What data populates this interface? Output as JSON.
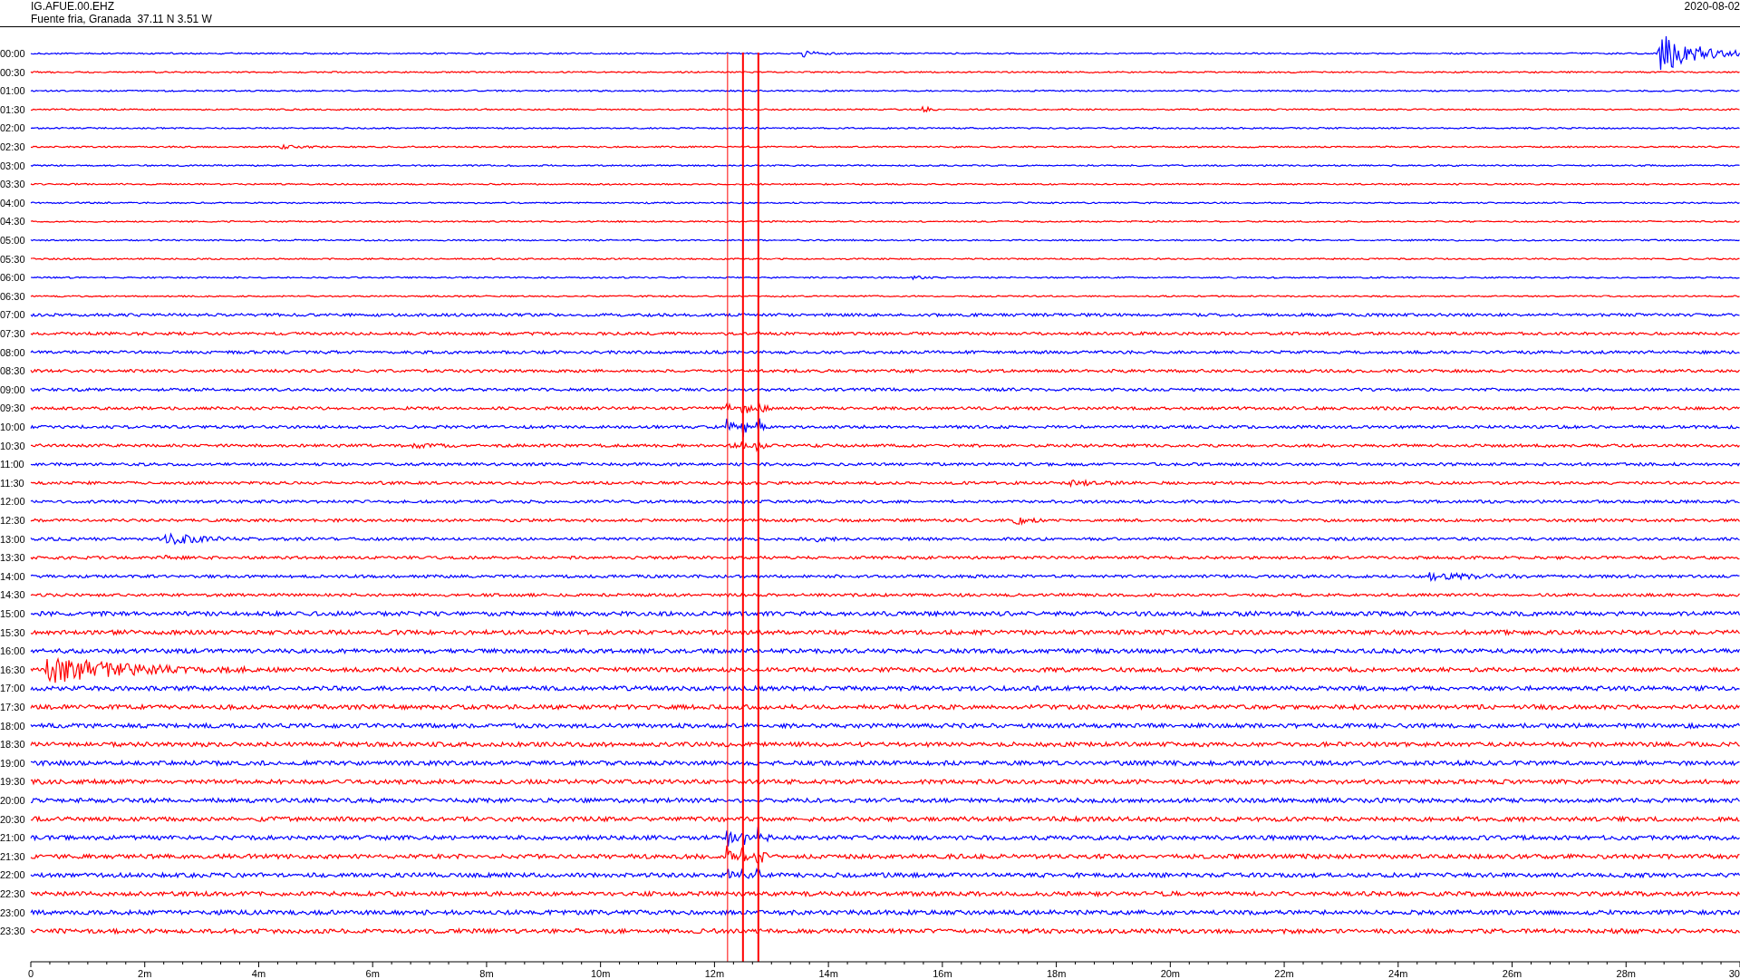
{
  "header": {
    "station": "IG.AFUE.00.EHZ",
    "location": "Fuente fria, Granada  37.11 N 3.51 W",
    "date": "2020-08-02"
  },
  "rows": [
    {
      "time": "00:00",
      "color": "#0000ff"
    },
    {
      "time": "00:30",
      "color": "#ff0000"
    },
    {
      "time": "01:00",
      "color": "#0000ff"
    },
    {
      "time": "01:30",
      "color": "#ff0000"
    },
    {
      "time": "02:00",
      "color": "#0000ff"
    },
    {
      "time": "02:30",
      "color": "#ff0000"
    },
    {
      "time": "03:00",
      "color": "#0000ff"
    },
    {
      "time": "03:30",
      "color": "#ff0000"
    },
    {
      "time": "04:00",
      "color": "#0000ff"
    },
    {
      "time": "04:30",
      "color": "#ff0000"
    },
    {
      "time": "05:00",
      "color": "#0000ff"
    },
    {
      "time": "05:30",
      "color": "#ff0000"
    },
    {
      "time": "06:00",
      "color": "#0000ff"
    },
    {
      "time": "06:30",
      "color": "#ff0000"
    },
    {
      "time": "07:00",
      "color": "#0000ff"
    },
    {
      "time": "07:30",
      "color": "#ff0000"
    },
    {
      "time": "08:00",
      "color": "#0000ff"
    },
    {
      "time": "08:30",
      "color": "#ff0000"
    },
    {
      "time": "09:00",
      "color": "#0000ff"
    },
    {
      "time": "09:30",
      "color": "#ff0000"
    },
    {
      "time": "10:00",
      "color": "#0000ff"
    },
    {
      "time": "10:30",
      "color": "#ff0000"
    },
    {
      "time": "11:00",
      "color": "#0000ff"
    },
    {
      "time": "11:30",
      "color": "#ff0000"
    },
    {
      "time": "12:00",
      "color": "#0000ff"
    },
    {
      "time": "12:30",
      "color": "#ff0000"
    },
    {
      "time": "13:00",
      "color": "#0000ff"
    },
    {
      "time": "13:30",
      "color": "#ff0000"
    },
    {
      "time": "14:00",
      "color": "#0000ff"
    },
    {
      "time": "14:30",
      "color": "#ff0000"
    },
    {
      "time": "15:00",
      "color": "#0000ff"
    },
    {
      "time": "15:30",
      "color": "#ff0000"
    },
    {
      "time": "16:00",
      "color": "#0000ff"
    },
    {
      "time": "16:30",
      "color": "#ff0000"
    },
    {
      "time": "17:00",
      "color": "#0000ff"
    },
    {
      "time": "17:30",
      "color": "#ff0000"
    },
    {
      "time": "18:00",
      "color": "#0000ff"
    },
    {
      "time": "18:30",
      "color": "#ff0000"
    },
    {
      "time": "19:00",
      "color": "#0000ff"
    },
    {
      "time": "19:30",
      "color": "#ff0000"
    },
    {
      "time": "20:00",
      "color": "#0000ff"
    },
    {
      "time": "20:30",
      "color": "#ff0000"
    },
    {
      "time": "21:00",
      "color": "#0000ff"
    },
    {
      "time": "21:30",
      "color": "#ff0000"
    },
    {
      "time": "22:00",
      "color": "#0000ff"
    },
    {
      "time": "22:30",
      "color": "#ff0000"
    },
    {
      "time": "23:00",
      "color": "#0000ff"
    },
    {
      "time": "23:30",
      "color": "#ff0000"
    }
  ],
  "x_axis": {
    "ticks": [
      "0",
      "2m",
      "4m",
      "6m",
      "8m",
      "10m",
      "12m",
      "14m",
      "16m",
      "18m",
      "20m",
      "22m",
      "24m",
      "26m",
      "28m",
      "30"
    ]
  }
}
